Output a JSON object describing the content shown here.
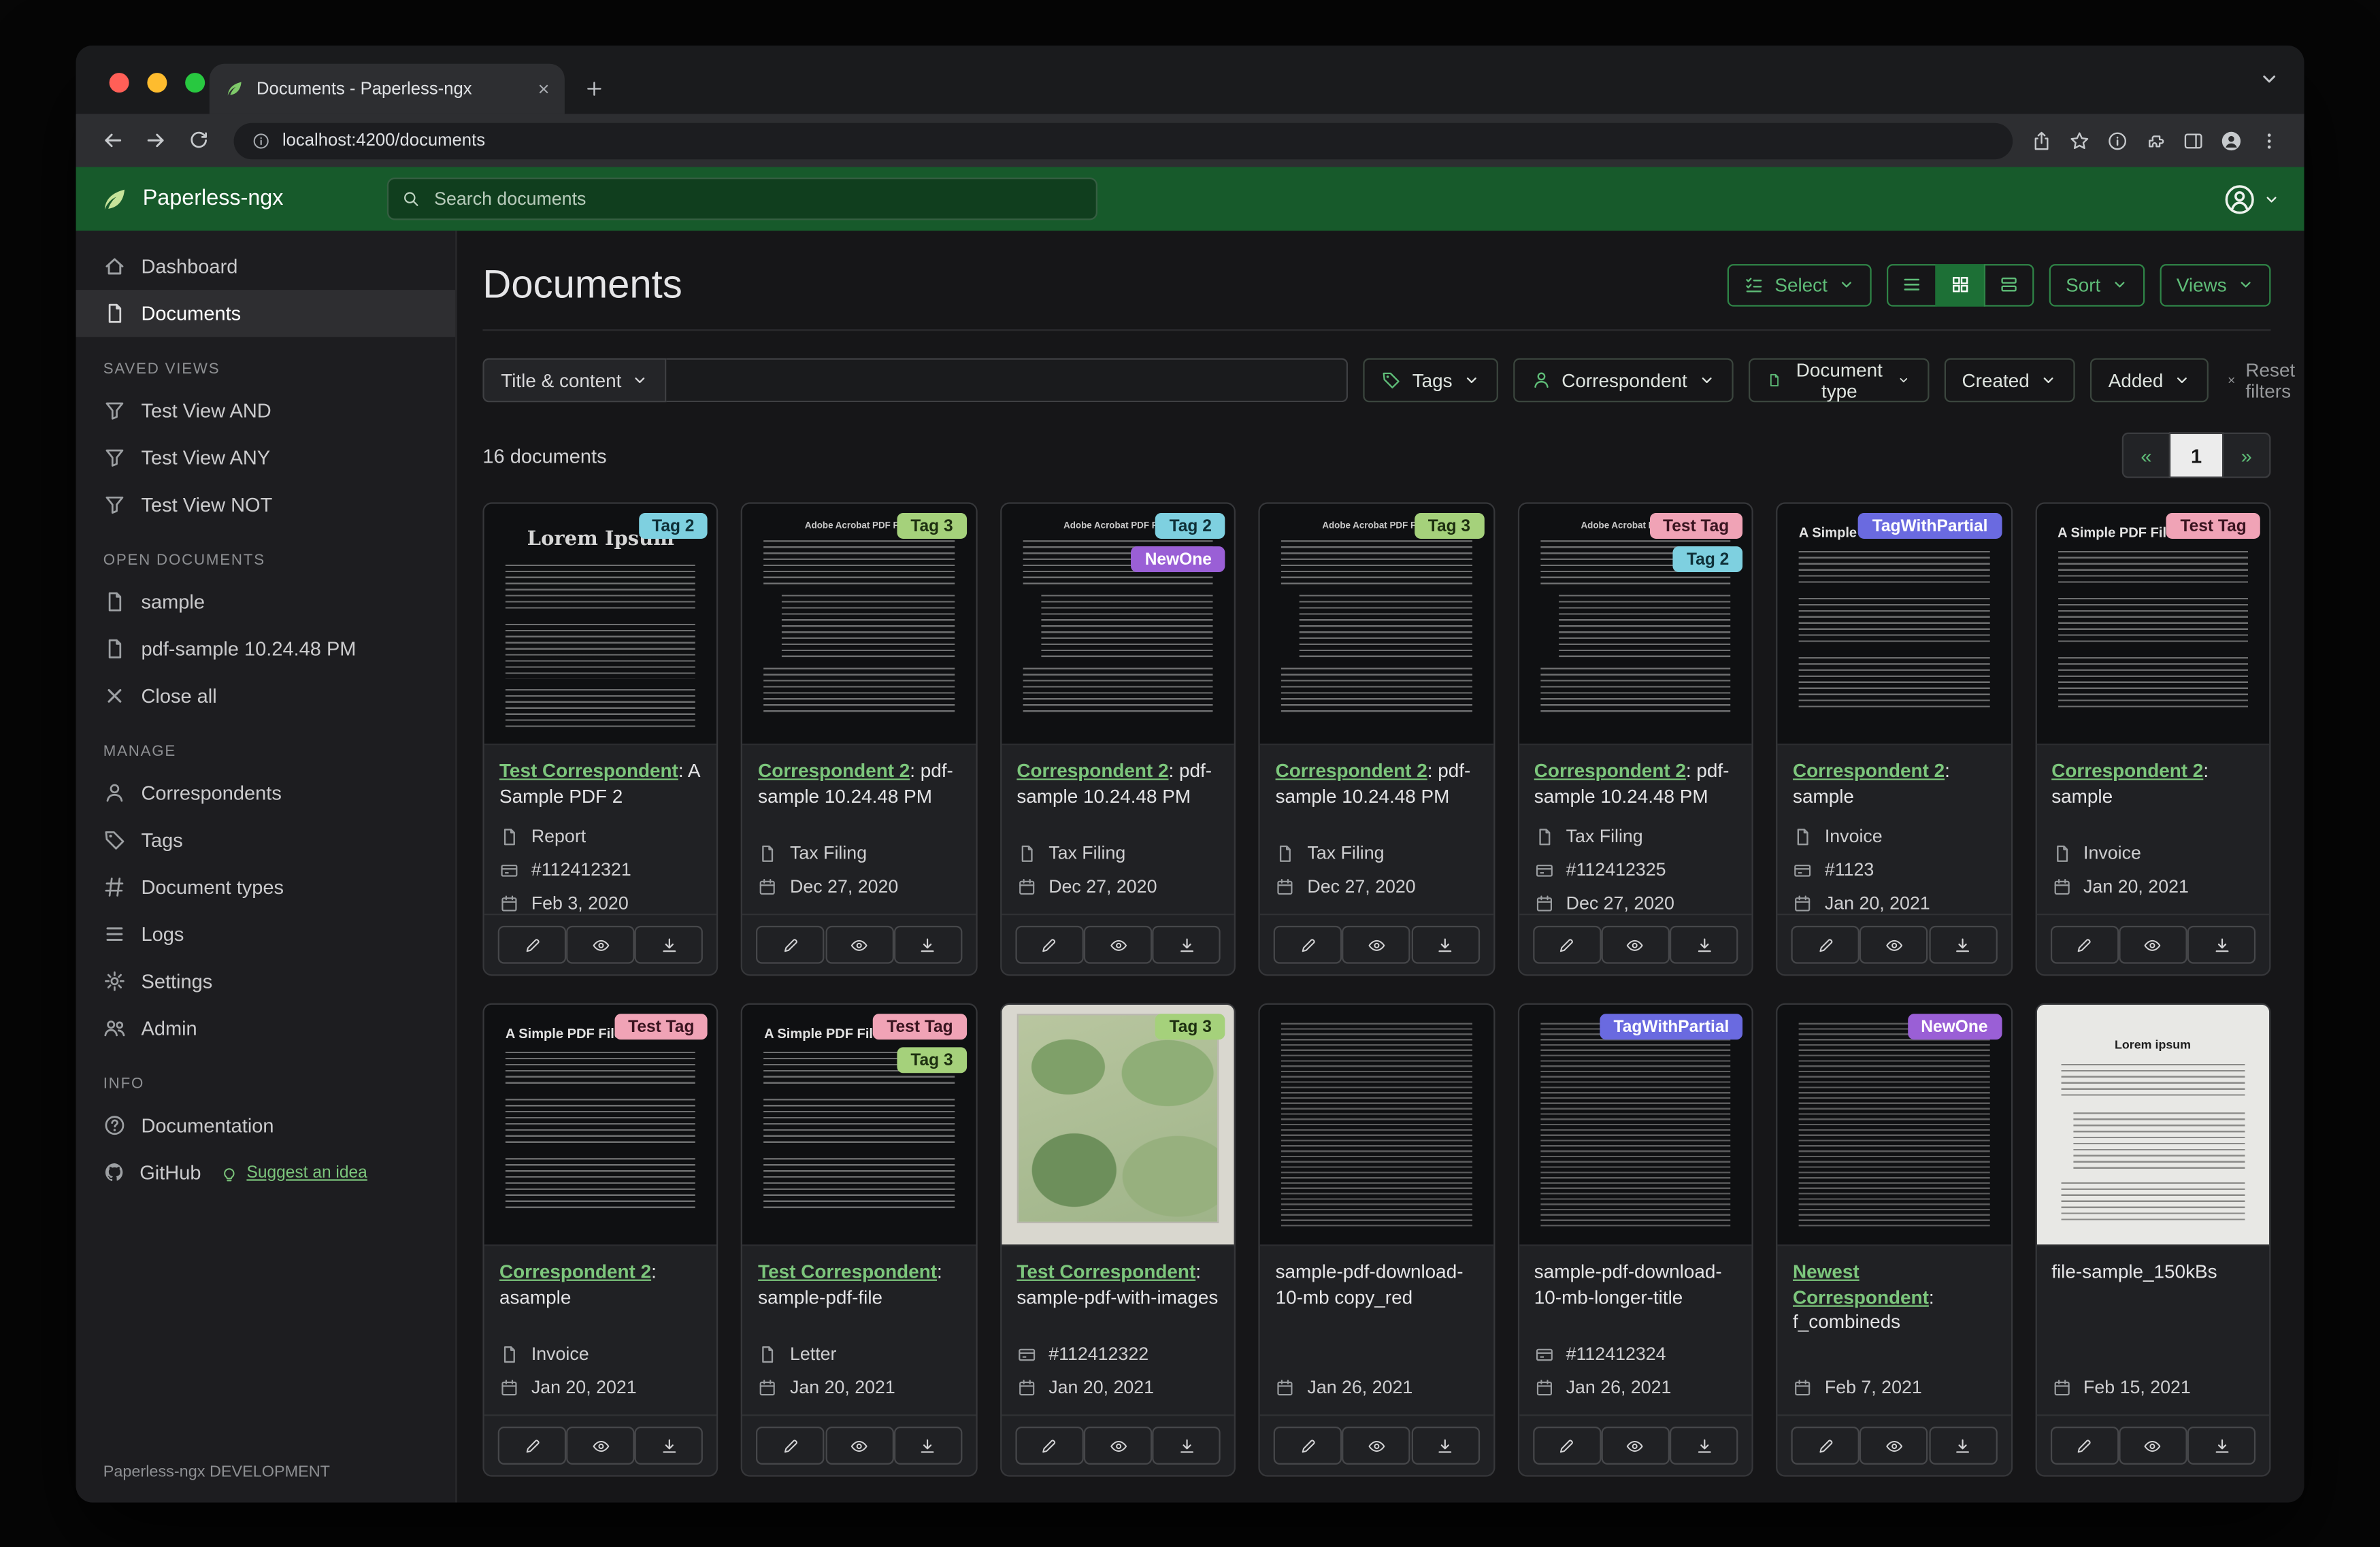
{
  "theme": {
    "header_green": "#175a2b",
    "accent_green": "#2f8547",
    "accent_text": "#5fbd78",
    "link_green": "#7cc67c",
    "toggle_active": "#1d7036"
  },
  "browser": {
    "tab_title": "Documents - Paperless-ngx",
    "url": "localhost:4200/documents"
  },
  "app_header": {
    "title": "Paperless-ngx",
    "search_placeholder": "Search documents"
  },
  "sidebar": {
    "nav": [
      {
        "label": "Dashboard"
      },
      {
        "label": "Documents"
      }
    ],
    "sections": {
      "saved": "SAVED VIEWS",
      "open": "OPEN DOCUMENTS",
      "manage": "MANAGE",
      "info": "INFO"
    },
    "saved_views": [
      "Test View AND",
      "Test View ANY",
      "Test View NOT"
    ],
    "open_documents": [
      "sample",
      "pdf-sample 10.24.48 PM"
    ],
    "close_all": "Close all",
    "manage": [
      "Correspondents",
      "Tags",
      "Document types",
      "Logs",
      "Settings",
      "Admin"
    ],
    "info": [
      "Documentation",
      "GitHub"
    ],
    "suggest": "Suggest an idea",
    "footer": "Paperless-ngx DEVELOPMENT"
  },
  "toolbar": {
    "title": "Documents",
    "select": "Select",
    "sort": "Sort",
    "views": "Views"
  },
  "filters": {
    "title_content": "Title & content",
    "tags": "Tags",
    "correspondent": "Correspondent",
    "document_type": "Document type",
    "created": "Created",
    "added": "Added",
    "reset": "Reset filters"
  },
  "results": {
    "count": "16 documents",
    "prev": "«",
    "page": "1",
    "next": "»"
  },
  "cards": [
    {
      "thumb": "lorem",
      "thumb_title": "Lorem Ipsum",
      "tags": [
        {
          "label": "Tag 2",
          "bg": "#7ed0e0",
          "fg": "#0f3038"
        }
      ],
      "title_link": "Test Correspondent",
      "title_rest": ": A Sample PDF 2",
      "doc_type": "Report",
      "asn": "#112412321",
      "date": "Feb 3, 2020"
    },
    {
      "thumb": "acrobat",
      "thumb_title": "Adobe Acrobat PDF Files",
      "tags": [
        {
          "label": "Tag 3",
          "bg": "#a5d17b",
          "fg": "#1d2f10"
        }
      ],
      "title_link": "Correspondent 2",
      "title_rest": ": pdf-sample 10.24.48 PM",
      "doc_type": "Tax Filing",
      "asn": null,
      "date": "Dec 27, 2020"
    },
    {
      "thumb": "acrobat",
      "thumb_title": "Adobe Acrobat PDF Files",
      "tags": [
        {
          "label": "Tag 2",
          "bg": "#7ed0e0",
          "fg": "#0f3038"
        },
        {
          "label": "NewOne",
          "bg": "#9a5fd6",
          "fg": "#ffffff"
        }
      ],
      "title_link": "Correspondent 2",
      "title_rest": ": pdf-sample 10.24.48 PM",
      "doc_type": "Tax Filing",
      "asn": null,
      "date": "Dec 27, 2020"
    },
    {
      "thumb": "acrobat",
      "thumb_title": "Adobe Acrobat PDF Files",
      "tags": [
        {
          "label": "Tag 3",
          "bg": "#a5d17b",
          "fg": "#1d2f10"
        }
      ],
      "title_link": "Correspondent 2",
      "title_rest": ": pdf-sample 10.24.48 PM",
      "doc_type": "Tax Filing",
      "asn": null,
      "date": "Dec 27, 2020"
    },
    {
      "thumb": "acrobat",
      "thumb_title": "Adobe Acrobat PDF Files",
      "tags": [
        {
          "label": "Test Tag",
          "bg": "#f0a3b6",
          "fg": "#3a1420"
        },
        {
          "label": "Tag 2",
          "bg": "#7ed0e0",
          "fg": "#0f3038"
        }
      ],
      "title_link": "Correspondent 2",
      "title_rest": ": pdf-sample 10.24.48 PM",
      "doc_type": "Tax Filing",
      "asn": "#112412325",
      "date": "Dec 27, 2020"
    },
    {
      "thumb": "simple",
      "thumb_title": "A Simple PDF File",
      "tags": [
        {
          "label": "TagWithPartial",
          "bg": "#6a6ae0",
          "fg": "#ffffff"
        }
      ],
      "title_link": "Correspondent 2",
      "title_rest": ": sample",
      "doc_type": "Invoice",
      "asn": "#1123",
      "date": "Jan 20, 2021"
    },
    {
      "thumb": "simple",
      "thumb_title": "A Simple PDF File",
      "tags": [
        {
          "label": "Test Tag",
          "bg": "#f0a3b6",
          "fg": "#3a1420"
        }
      ],
      "title_link": "Correspondent 2",
      "title_rest": ": sample",
      "doc_type": "Invoice",
      "asn": null,
      "date": "Jan 20, 2021"
    },
    {
      "thumb": "simple",
      "thumb_title": "A Simple PDF File",
      "tags": [
        {
          "label": "Test Tag",
          "bg": "#f0a3b6",
          "fg": "#3a1420"
        }
      ],
      "title_link": "Correspondent 2",
      "title_rest": ": asample",
      "doc_type": "Invoice",
      "asn": null,
      "date": "Jan 20, 2021"
    },
    {
      "thumb": "simple",
      "thumb_title": "A Simple PDF File",
      "tags": [
        {
          "label": "Test Tag",
          "bg": "#f0a3b6",
          "fg": "#3a1420"
        },
        {
          "label": "Tag 3",
          "bg": "#a5d17b",
          "fg": "#1d2f10"
        }
      ],
      "title_link": "Test Correspondent",
      "title_rest": ": sample-pdf-file",
      "doc_type": "Letter",
      "asn": null,
      "date": "Jan 20, 2021"
    },
    {
      "thumb": "map",
      "thumb_title": null,
      "tags": [
        {
          "label": "Tag 3",
          "bg": "#a5d17b",
          "fg": "#1d2f10"
        }
      ],
      "title_link": "Test Correspondent",
      "title_rest": ": sample-pdf-with-images",
      "doc_type": null,
      "asn": "#112412322",
      "date": "Jan 20, 2021"
    },
    {
      "thumb": "dense",
      "thumb_title": null,
      "tags": [],
      "title_link": null,
      "title_rest": "sample-pdf-download-10-mb copy_red",
      "doc_type": null,
      "asn": null,
      "date": "Jan 26, 2021"
    },
    {
      "thumb": "dense",
      "thumb_title": null,
      "tags": [
        {
          "label": "TagWithPartial",
          "bg": "#6a6ae0",
          "fg": "#ffffff"
        }
      ],
      "title_link": null,
      "title_rest": "sample-pdf-download-10-mb-longer-title",
      "doc_type": null,
      "asn": "#112412324",
      "date": "Jan 26, 2021"
    },
    {
      "thumb": "dense",
      "thumb_title": null,
      "tags": [
        {
          "label": "NewOne",
          "bg": "#9a5fd6",
          "fg": "#ffffff"
        }
      ],
      "title_link": "Newest Correspondent",
      "title_rest": ": f_combineds",
      "doc_type": null,
      "asn": null,
      "date": "Feb 7, 2021"
    },
    {
      "thumb": "white",
      "thumb_title": "Lorem ipsum",
      "tags": [],
      "title_link": null,
      "title_rest": "file-sample_150kBs",
      "doc_type": null,
      "asn": null,
      "date": "Feb 15, 2021"
    }
  ]
}
